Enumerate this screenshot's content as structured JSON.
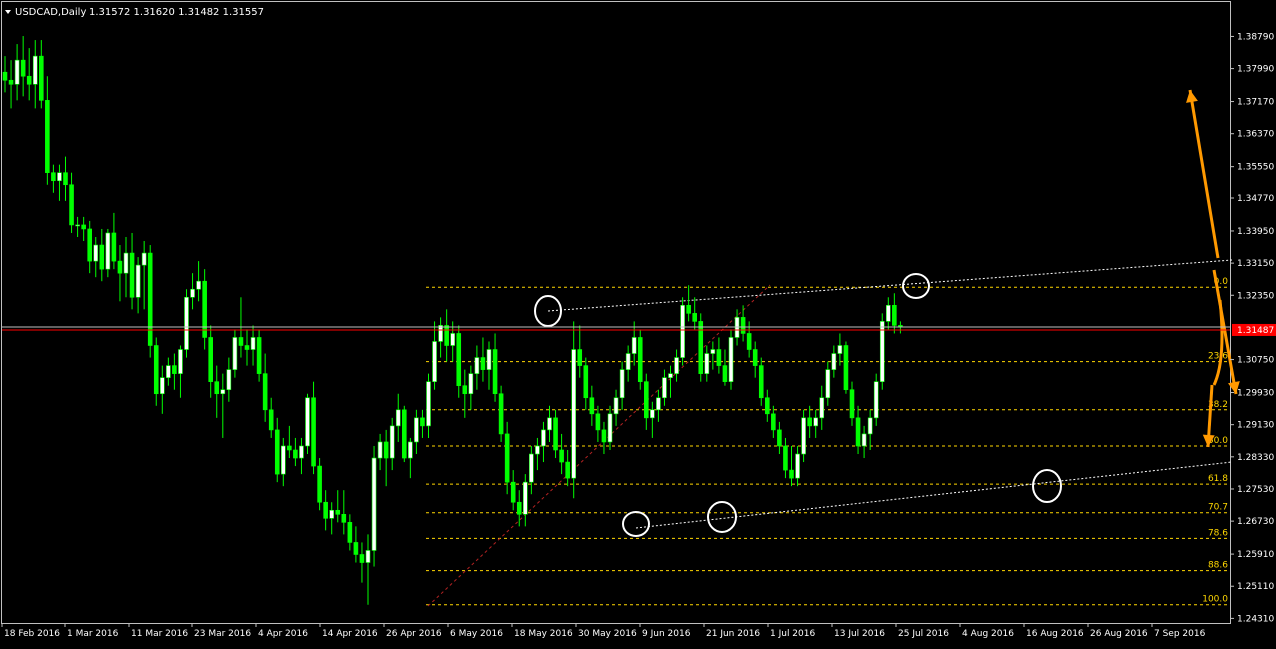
{
  "header": {
    "symbol_label": "USDCAD,Daily",
    "ohlc": "1.31572 1.31620 1.31482 1.31557"
  },
  "colors": {
    "background": "#000000",
    "frame": "#c0c0c0",
    "bull_candle": "#ffffff",
    "bear_candle": "#00ff00",
    "wick": "#00ff00",
    "price_line": "#ff0000",
    "fib_levels": "#ffd700",
    "trendlines": "#ffffff",
    "diagonal": "#b22222",
    "arrows": "#ff9900",
    "marker_circles": "#ffffff"
  },
  "chart_data": {
    "type": "candlestick",
    "symbol": "USDCAD",
    "timeframe": "Daily",
    "current_price": "1.31487",
    "yaxis": {
      "ylim": [
        1.2427,
        1.3905
      ],
      "tick_labels": [
        "1.38790",
        "1.37990",
        "1.37170",
        "1.36370",
        "1.35550",
        "1.34770",
        "1.33950",
        "1.33150",
        "1.32350",
        "1.31487",
        "1.30750",
        "1.29930",
        "1.29130",
        "1.28330",
        "1.27530",
        "1.26730",
        "1.25910",
        "1.25110",
        "1.24310"
      ]
    },
    "xaxis": {
      "tick_labels": [
        "18 Feb 2016",
        "1 Mar 2016",
        "11 Mar 2016",
        "23 Mar 2016",
        "4 Apr 2016",
        "14 Apr 2016",
        "26 Apr 2016",
        "6 May 2016",
        "18 May 2016",
        "30 May 2016",
        "9 Jun 2016",
        "21 Jun 2016",
        "1 Jul 2016",
        "13 Jul 2016",
        "25 Jul 2016",
        "4 Aug 2016",
        "16 Aug 2016",
        "26 Aug 2016",
        "7 Sep 2016"
      ]
    },
    "candles_ohlc": [
      [
        1.379,
        1.383,
        1.374,
        1.377
      ],
      [
        1.377,
        1.382,
        1.37,
        1.376
      ],
      [
        1.376,
        1.386,
        1.372,
        1.382
      ],
      [
        1.382,
        1.388,
        1.373,
        1.378
      ],
      [
        1.378,
        1.385,
        1.372,
        1.376
      ],
      [
        1.376,
        1.387,
        1.37,
        1.383
      ],
      [
        1.383,
        1.387,
        1.37,
        1.372
      ],
      [
        1.372,
        1.378,
        1.351,
        1.354
      ],
      [
        1.354,
        1.356,
        1.349,
        1.352
      ],
      [
        1.352,
        1.356,
        1.347,
        1.354
      ],
      [
        1.354,
        1.358,
        1.347,
        1.351
      ],
      [
        1.351,
        1.354,
        1.339,
        1.341
      ],
      [
        1.341,
        1.343,
        1.338,
        1.341
      ],
      [
        1.341,
        1.343,
        1.337,
        1.34
      ],
      [
        1.34,
        1.342,
        1.329,
        1.332
      ],
      [
        1.332,
        1.338,
        1.328,
        1.336
      ],
      [
        1.336,
        1.34,
        1.327,
        1.33
      ],
      [
        1.33,
        1.34,
        1.328,
        1.339
      ],
      [
        1.339,
        1.344,
        1.33,
        1.332
      ],
      [
        1.332,
        1.336,
        1.322,
        1.329
      ],
      [
        1.329,
        1.338,
        1.323,
        1.334
      ],
      [
        1.334,
        1.339,
        1.32,
        1.323
      ],
      [
        1.323,
        1.333,
        1.319,
        1.331
      ],
      [
        1.331,
        1.337,
        1.32,
        1.334
      ],
      [
        1.334,
        1.336,
        1.308,
        1.311
      ],
      [
        1.311,
        1.313,
        1.296,
        1.299
      ],
      [
        1.299,
        1.306,
        1.294,
        1.303
      ],
      [
        1.303,
        1.308,
        1.301,
        1.306
      ],
      [
        1.306,
        1.309,
        1.3,
        1.304
      ],
      [
        1.304,
        1.311,
        1.298,
        1.31
      ],
      [
        1.31,
        1.325,
        1.308,
        1.323
      ],
      [
        1.323,
        1.329,
        1.32,
        1.325
      ],
      [
        1.325,
        1.332,
        1.322,
        1.327
      ],
      [
        1.327,
        1.33,
        1.31,
        1.313
      ],
      [
        1.313,
        1.316,
        1.298,
        1.302
      ],
      [
        1.302,
        1.306,
        1.293,
        1.299
      ],
      [
        1.299,
        1.304,
        1.288,
        1.3
      ],
      [
        1.3,
        1.308,
        1.297,
        1.305
      ],
      [
        1.305,
        1.315,
        1.303,
        1.313
      ],
      [
        1.313,
        1.323,
        1.308,
        1.311
      ],
      [
        1.311,
        1.315,
        1.306,
        1.31
      ],
      [
        1.31,
        1.316,
        1.306,
        1.313
      ],
      [
        1.313,
        1.315,
        1.302,
        1.304
      ],
      [
        1.304,
        1.309,
        1.292,
        1.295
      ],
      [
        1.295,
        1.298,
        1.288,
        1.29
      ],
      [
        1.29,
        1.293,
        1.277,
        1.279
      ],
      [
        1.279,
        1.288,
        1.276,
        1.286
      ],
      [
        1.286,
        1.291,
        1.283,
        1.285
      ],
      [
        1.285,
        1.288,
        1.281,
        1.283
      ],
      [
        1.283,
        1.288,
        1.279,
        1.286
      ],
      [
        1.286,
        1.299,
        1.284,
        1.298
      ],
      [
        1.298,
        1.302,
        1.279,
        1.281
      ],
      [
        1.281,
        1.283,
        1.27,
        1.272
      ],
      [
        1.272,
        1.275,
        1.265,
        1.268
      ],
      [
        1.268,
        1.272,
        1.264,
        1.27
      ],
      [
        1.27,
        1.275,
        1.267,
        1.269
      ],
      [
        1.269,
        1.275,
        1.264,
        1.267
      ],
      [
        1.267,
        1.269,
        1.26,
        1.262
      ],
      [
        1.262,
        1.266,
        1.257,
        1.259
      ],
      [
        1.259,
        1.262,
        1.252,
        1.257
      ],
      [
        1.257,
        1.264,
        1.2465,
        1.26
      ],
      [
        1.26,
        1.286,
        1.256,
        1.283
      ],
      [
        1.283,
        1.289,
        1.28,
        1.287
      ],
      [
        1.287,
        1.29,
        1.276,
        1.283
      ],
      [
        1.283,
        1.293,
        1.28,
        1.291
      ],
      [
        1.291,
        1.299,
        1.287,
        1.295
      ],
      [
        1.295,
        1.296,
        1.282,
        1.283
      ],
      [
        1.283,
        1.288,
        1.278,
        1.287
      ],
      [
        1.287,
        1.295,
        1.284,
        1.293
      ],
      [
        1.293,
        1.295,
        1.288,
        1.291
      ],
      [
        1.291,
        1.304,
        1.288,
        1.302
      ],
      [
        1.302,
        1.317,
        1.3,
        1.312
      ],
      [
        1.312,
        1.318,
        1.308,
        1.316
      ],
      [
        1.316,
        1.32,
        1.307,
        1.311
      ],
      [
        1.311,
        1.317,
        1.307,
        1.314
      ],
      [
        1.314,
        1.316,
        1.298,
        1.301
      ],
      [
        1.301,
        1.305,
        1.293,
        1.299
      ],
      [
        1.299,
        1.306,
        1.295,
        1.304
      ],
      [
        1.304,
        1.311,
        1.3,
        1.308
      ],
      [
        1.308,
        1.313,
        1.302,
        1.305
      ],
      [
        1.305,
        1.312,
        1.3,
        1.31
      ],
      [
        1.31,
        1.314,
        1.297,
        1.299
      ],
      [
        1.299,
        1.301,
        1.287,
        1.289
      ],
      [
        1.289,
        1.292,
        1.274,
        1.277
      ],
      [
        1.277,
        1.28,
        1.27,
        1.272
      ],
      [
        1.272,
        1.275,
        1.266,
        1.269
      ],
      [
        1.269,
        1.279,
        1.266,
        1.277
      ],
      [
        1.277,
        1.286,
        1.274,
        1.284
      ],
      [
        1.284,
        1.288,
        1.28,
        1.286
      ],
      [
        1.286,
        1.292,
        1.282,
        1.29
      ],
      [
        1.29,
        1.296,
        1.287,
        1.293
      ],
      [
        1.293,
        1.295,
        1.283,
        1.285
      ],
      [
        1.285,
        1.289,
        1.279,
        1.282
      ],
      [
        1.282,
        1.285,
        1.276,
        1.278
      ],
      [
        1.278,
        1.317,
        1.273,
        1.31
      ],
      [
        1.31,
        1.316,
        1.303,
        1.306
      ],
      [
        1.306,
        1.308,
        1.295,
        1.298
      ],
      [
        1.298,
        1.301,
        1.291,
        1.294
      ],
      [
        1.294,
        1.296,
        1.287,
        1.29
      ],
      [
        1.29,
        1.292,
        1.284,
        1.287
      ],
      [
        1.287,
        1.296,
        1.285,
        1.294
      ],
      [
        1.294,
        1.3,
        1.291,
        1.298
      ],
      [
        1.298,
        1.307,
        1.295,
        1.305
      ],
      [
        1.305,
        1.311,
        1.302,
        1.309
      ],
      [
        1.309,
        1.317,
        1.306,
        1.313
      ],
      [
        1.313,
        1.315,
        1.3,
        1.302
      ],
      [
        1.302,
        1.304,
        1.29,
        1.293
      ],
      [
        1.293,
        1.297,
        1.288,
        1.295
      ],
      [
        1.295,
        1.3,
        1.292,
        1.298
      ],
      [
        1.298,
        1.305,
        1.296,
        1.303
      ],
      [
        1.303,
        1.306,
        1.298,
        1.304
      ],
      [
        1.304,
        1.31,
        1.302,
        1.308
      ],
      [
        1.308,
        1.323,
        1.306,
        1.321
      ],
      [
        1.321,
        1.326,
        1.317,
        1.319
      ],
      [
        1.319,
        1.323,
        1.315,
        1.317
      ],
      [
        1.317,
        1.319,
        1.302,
        1.304
      ],
      [
        1.304,
        1.311,
        1.302,
        1.309
      ],
      [
        1.309,
        1.312,
        1.305,
        1.31
      ],
      [
        1.31,
        1.313,
        1.304,
        1.306
      ],
      [
        1.306,
        1.31,
        1.301,
        1.302
      ],
      [
        1.302,
        1.315,
        1.3,
        1.313
      ],
      [
        1.313,
        1.32,
        1.311,
        1.318
      ],
      [
        1.318,
        1.321,
        1.312,
        1.314
      ],
      [
        1.314,
        1.317,
        1.308,
        1.31
      ],
      [
        1.31,
        1.312,
        1.303,
        1.306
      ],
      [
        1.306,
        1.308,
        1.296,
        1.298
      ],
      [
        1.298,
        1.3,
        1.292,
        1.294
      ],
      [
        1.294,
        1.296,
        1.288,
        1.29
      ],
      [
        1.29,
        1.292,
        1.284,
        1.286
      ],
      [
        1.286,
        1.288,
        1.278,
        1.28
      ],
      [
        1.28,
        1.286,
        1.276,
        1.278
      ],
      [
        1.278,
        1.286,
        1.276,
        1.284
      ],
      [
        1.284,
        1.295,
        1.282,
        1.293
      ],
      [
        1.293,
        1.296,
        1.288,
        1.291
      ],
      [
        1.291,
        1.295,
        1.288,
        1.293
      ],
      [
        1.293,
        1.301,
        1.29,
        1.298
      ],
      [
        1.298,
        1.307,
        1.296,
        1.305
      ],
      [
        1.305,
        1.311,
        1.303,
        1.309
      ],
      [
        1.309,
        1.314,
        1.306,
        1.311
      ],
      [
        1.311,
        1.312,
        1.299,
        1.3
      ],
      [
        1.3,
        1.302,
        1.291,
        1.293
      ],
      [
        1.293,
        1.296,
        1.284,
        1.286
      ],
      [
        1.286,
        1.291,
        1.283,
        1.289
      ],
      [
        1.289,
        1.295,
        1.285,
        1.293
      ],
      [
        1.293,
        1.304,
        1.291,
        1.302
      ],
      [
        1.302,
        1.319,
        1.3,
        1.317
      ],
      [
        1.317,
        1.323,
        1.315,
        1.321
      ],
      [
        1.321,
        1.324,
        1.314,
        1.316
      ],
      [
        1.316,
        1.317,
        1.314,
        1.3157
      ]
    ],
    "fibonacci_levels": [
      {
        "label": "0.0",
        "price": 1.3255
      },
      {
        "label": "23.6",
        "price": 1.307
      },
      {
        "label": "38.2",
        "price": 1.295
      },
      {
        "label": "50.0",
        "price": 1.286
      },
      {
        "label": "61.8",
        "price": 1.2765
      },
      {
        "label": "70.7",
        "price": 1.2694
      },
      {
        "label": "78.6",
        "price": 1.263
      },
      {
        "label": "88.6",
        "price": 1.255
      },
      {
        "label": "100.0",
        "price": 1.2465
      }
    ]
  }
}
